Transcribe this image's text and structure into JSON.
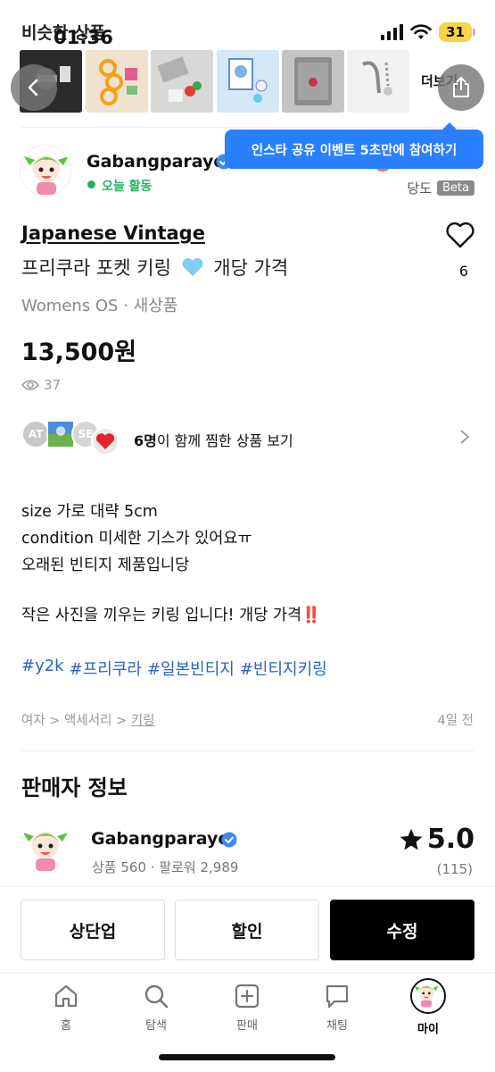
{
  "status_bar": {
    "overlay_text": "비슷한 상품",
    "time": "01:36",
    "battery": "31"
  },
  "similar": {
    "more_label": "더보기",
    "thumbnails": [
      "keychain-dark",
      "keychain-orange",
      "keychain-charms",
      "keychain-blue",
      "card-pocket",
      "keychain-silver"
    ]
  },
  "tooltip": {
    "text": "인스타 공유 이벤트 5초만에 참여하기"
  },
  "seller": {
    "name": "Gabangparayo",
    "activity": "오늘 활동",
    "dangdo": "당도",
    "beta": "Beta"
  },
  "product": {
    "brand": "Japanese Vintage",
    "title_before": "프리쿠라 포켓 키링",
    "title_after": "개당 가격",
    "size": "Womens OS",
    "condition": "새상품",
    "price": "13,500원",
    "views": "37",
    "likes": "6"
  },
  "wishlist": {
    "avatars": [
      "AT",
      "",
      "SE"
    ],
    "count": "6명",
    "text": "이 함께 찜한 상품 보기"
  },
  "description": {
    "lines": [
      "size 가로 대략 5cm",
      "condition 미세한 기스가 있어요ㅠ",
      "오래된 빈티지 제품입니당",
      "작은 사진을 끼우는 키링 입니다! 개당 가격‼️"
    ],
    "hashtags": [
      "#y2k",
      "#프리쿠라",
      "#일본빈티지",
      "#빈티지키링"
    ]
  },
  "breadcrumb": {
    "path": "여자 > 액세서리 > ",
    "last": "키링",
    "posted": "4일 전"
  },
  "seller_info": {
    "section_title": "판매자 정보",
    "name": "Gabangparayo",
    "stats": "상품 560 · 팔로워 2,989",
    "rating": "5.0",
    "review_count": "(115)"
  },
  "actions": {
    "bump": "상단업",
    "discount": "할인",
    "edit": "수정"
  },
  "tabs": {
    "home": "홈",
    "search": "탐색",
    "sell": "판매",
    "chat": "채팅",
    "my": "마이"
  },
  "colors": {
    "accent_blue": "#2a7fff",
    "hashtag_blue": "#2a63c7",
    "active_green": "#27b15d",
    "battery_yellow": "#f7d24a"
  }
}
